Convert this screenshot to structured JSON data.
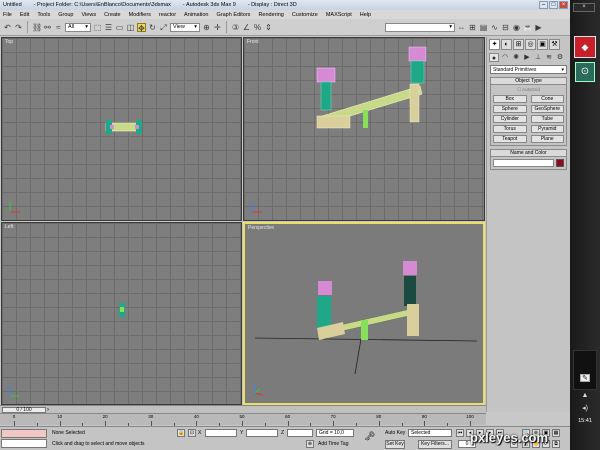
{
  "window": {
    "title_parts": [
      "Untitled",
      "- Project Folder: C:\\Users\\EnBlanco\\Documents\\3dsmax",
      "- Autodesk 3ds Max 9",
      "- Display : Direct 3D"
    ]
  },
  "menubar": [
    "File",
    "Edit",
    "Tools",
    "Group",
    "Views",
    "Create",
    "Modifiers",
    "reactor",
    "Animation",
    "Graph Editors",
    "Rendering",
    "Customize",
    "MAXScript",
    "Help"
  ],
  "toolbar": {
    "filter_value": "All",
    "refcoord_value": "View"
  },
  "viewports": {
    "top": "Top",
    "front": "Front",
    "left": "Left",
    "perspective": "Perspective"
  },
  "command_panel": {
    "primitive_type": "Standard Primitives",
    "object_type_header": "Object Type",
    "autogrid_label": "AutoGrid",
    "object_buttons": [
      "Box",
      "Cone",
      "Sphere",
      "GeoSphere",
      "Cylinder",
      "Tube",
      "Torus",
      "Pyramid",
      "Teapot",
      "Plane"
    ],
    "name_color_header": "Name and Color",
    "swatch_color": "#8b0a24"
  },
  "timeline": {
    "frame_display": "0 / 100",
    "ticks": [
      "0",
      "10",
      "20",
      "30",
      "40",
      "50",
      "60",
      "70",
      "80",
      "90",
      "100"
    ]
  },
  "statusbar": {
    "selection": "None Selected",
    "prompt": "Click and drag to select and move objects",
    "x_label": "X",
    "y_label": "Y",
    "z_label": "Z",
    "grid": "Grid = 10,0",
    "add_time_tag": "Add Time Tag",
    "auto_key": "Auto Key",
    "selected_value": "Selected",
    "set_key": "Set Key",
    "key_filters": "Key Filters...",
    "frame_value": "0"
  },
  "system": {
    "clock": "15:41"
  },
  "watermark": "pxleyes.com",
  "colors": {
    "viewport_bg": "#7e7e7e",
    "active_border": "#e6e06a",
    "teal": "#1fa888",
    "pink": "#d68ad4",
    "tan": "#d8cf9a",
    "green": "#86e05a"
  }
}
